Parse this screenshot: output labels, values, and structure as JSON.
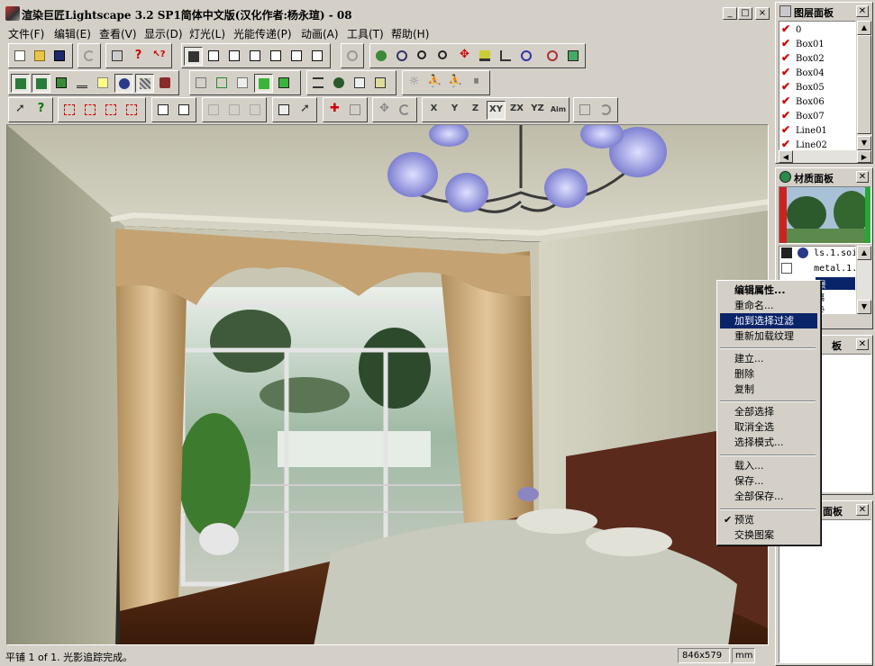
{
  "window": {
    "title": "渲染巨匠Lightscape 3.2 SP1简体中文版(汉化作者:杨永瑄) - 08",
    "minimize": "_",
    "maximize": "□",
    "close": "×"
  },
  "menu": {
    "items": [
      "文件(F)",
      "编辑(E)",
      "查看(V)",
      "显示(D)",
      "灯光(L)",
      "光能传递(P)",
      "动画(A)",
      "工具(T)",
      "帮助(H)"
    ]
  },
  "toolbar": {
    "axis_labels": [
      "X",
      "Y",
      "Z",
      "XY",
      "ZX",
      "YZ",
      "Aim"
    ]
  },
  "layers_panel": {
    "title": "图层面板",
    "layers": [
      "0",
      "Box01",
      "Box02",
      "Box04",
      "Box05",
      "Box06",
      "Box07",
      "Line01",
      "Line02"
    ]
  },
  "materials_panel": {
    "title": "材质面板",
    "items": [
      "ls.1.soil",
      "metal.1.",
      "景",
      "璃",
      "垫"
    ]
  },
  "hidden_panels": {
    "panel3_fragment": "板",
    "panel4_fragment": "面板"
  },
  "context_menu": {
    "items": [
      {
        "label": "编辑属性...",
        "bold": true
      },
      {
        "label": "重命名..."
      },
      {
        "label": "加到选择过滤",
        "selected": true
      },
      {
        "label": "重新加载纹理"
      },
      {
        "separator": true
      },
      {
        "label": "建立..."
      },
      {
        "label": "删除"
      },
      {
        "label": "复制"
      },
      {
        "separator": true
      },
      {
        "label": "全部选择"
      },
      {
        "label": "取消全选"
      },
      {
        "label": "选择模式..."
      },
      {
        "separator": true
      },
      {
        "label": "载入..."
      },
      {
        "label": "保存..."
      },
      {
        "label": "全部保存..."
      },
      {
        "separator": true
      },
      {
        "label": "预览",
        "checked": true
      },
      {
        "label": "交换图案"
      }
    ]
  },
  "status": {
    "text": "平铺 1 of 1. 光影追踪完成。",
    "resolution": "846x579",
    "unit": "mm"
  },
  "colors": {
    "face": "#d4d0c8",
    "selection": "#0a246a",
    "layer_check": "#cc0000"
  }
}
